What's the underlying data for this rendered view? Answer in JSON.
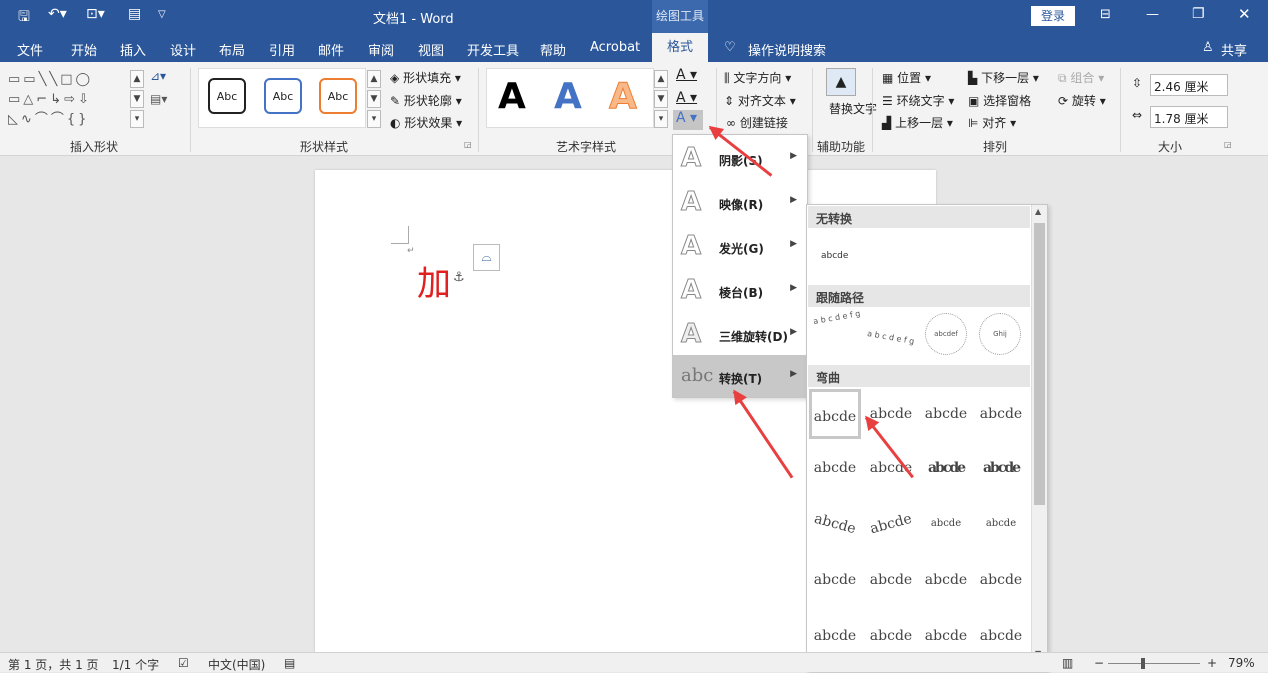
{
  "window": {
    "doc_title": "文档1",
    "separator": "-",
    "app": "Word",
    "context_tab_group": "绘图工具",
    "login": "登录"
  },
  "tabs": [
    "文件",
    "开始",
    "插入",
    "设计",
    "布局",
    "引用",
    "邮件",
    "审阅",
    "视图",
    "开发工具",
    "帮助",
    "Acrobat",
    "格式"
  ],
  "tell_me": "操作说明搜索",
  "share": "共享",
  "ribbon": {
    "groups": {
      "insert_shapes": "插入形状",
      "shape_styles": "形状样式",
      "wordart_styles": "艺术字样式",
      "accessibility": "辅助功能",
      "arrange": "排列",
      "size": "大小"
    },
    "shape_style_sample": "Abc",
    "wordart_sample": "A",
    "shape_fill": "形状填充",
    "shape_outline": "形状轮廓",
    "shape_effect": "形状效果",
    "text_direction": "文字方向",
    "align_text": "对齐文本",
    "create_link": "创建链接",
    "alt_text": "替换文字",
    "position": "位置",
    "wrap_text": "环绕文字",
    "bring_forward": "上移一层",
    "send_backward": "下移一层",
    "selection_pane": "选择窗格",
    "align": "对齐",
    "group": "组合",
    "rotate": "旋转",
    "height": "2.46 厘米",
    "width": "1.78 厘米"
  },
  "document": {
    "text": "加"
  },
  "text_effects_menu": [
    {
      "label": "阴影(S)",
      "icon": "text-shadow-icon"
    },
    {
      "label": "映像(R)",
      "icon": "text-reflection-icon"
    },
    {
      "label": "发光(G)",
      "icon": "text-glow-icon"
    },
    {
      "label": "棱台(B)",
      "icon": "text-bevel-icon"
    },
    {
      "label": "三维旋转(D)",
      "icon": "text-3d-rotation-icon"
    },
    {
      "label": "转换(T)",
      "icon": "text-transform-icon"
    }
  ],
  "transform_submenu": {
    "no_transform": "无转换",
    "follow_path": "跟随路径",
    "warp": "弯曲",
    "sample": "abcde",
    "sample_small": "abcde"
  },
  "status": {
    "page": "第 1 页，共 1 页",
    "words": "1/1 个字",
    "language": "中文(中国)",
    "zoom": "79%"
  },
  "colors": {
    "brand": "#2b579a",
    "accent_arrow": "#e84040",
    "doc_text": "#e02020"
  }
}
